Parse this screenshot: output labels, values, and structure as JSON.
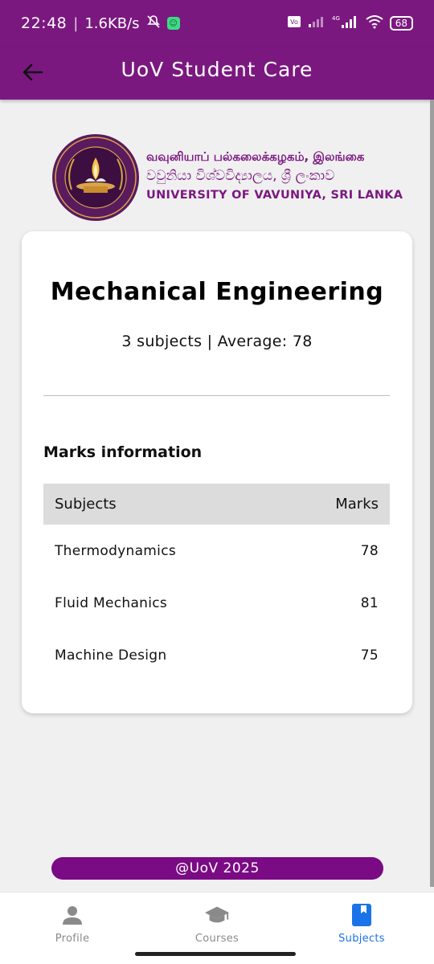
{
  "status_bar": {
    "time": "22:48",
    "net_speed": "1.6KB/s",
    "network": "4G",
    "battery": "68"
  },
  "app_bar": {
    "title": "UoV Student Care"
  },
  "logo": {
    "tamil": "வவுனியாப் பல்கலைக்கழகம், இலங்கை",
    "sinhala": "වවුනියා විශ්වවිද්‍යාලය, ශ්‍රී ලංකාව",
    "english": "UNIVERSITY OF VAVUNIYA, SRI LANKA"
  },
  "course": {
    "title": "Mechanical Engineering",
    "summary": "3 subjects | Average: 78"
  },
  "marks": {
    "section_title": "Marks information",
    "header": {
      "subject": "Subjects",
      "marks": "Marks"
    },
    "rows": [
      {
        "subject": "Thermodynamics",
        "marks": "78"
      },
      {
        "subject": "Fluid Mechanics",
        "marks": "81"
      },
      {
        "subject": "Machine Design",
        "marks": "75"
      }
    ]
  },
  "footer": {
    "text": "@UoV 2025"
  },
  "bottom_nav": {
    "items": [
      {
        "label": "Profile",
        "icon": "person-icon"
      },
      {
        "label": "Courses",
        "icon": "graduation-cap-icon"
      },
      {
        "label": "Subjects",
        "icon": "book-icon"
      }
    ],
    "active": "Subjects"
  },
  "colors": {
    "primary": "#7b1880",
    "active_nav": "#1a73e8"
  }
}
